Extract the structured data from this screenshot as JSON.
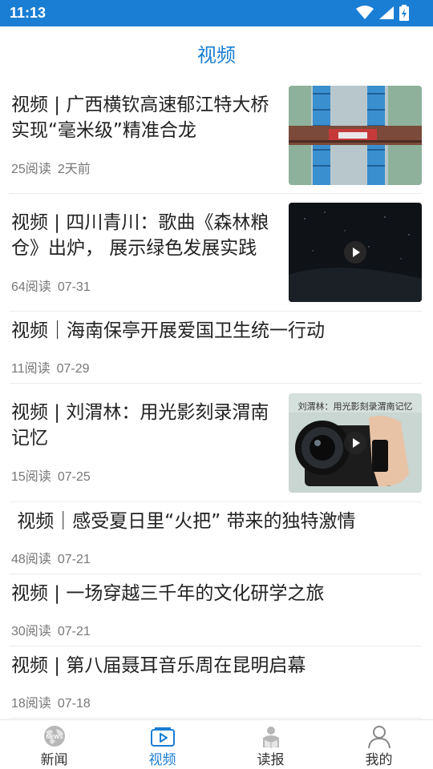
{
  "status_bar": {
    "time": "11:13"
  },
  "header": {
    "title": "视频"
  },
  "articles": [
    {
      "title": "视频 | 广西横钦高速郁江特大桥实现“毫米级”精准合龙",
      "reads": "25阅读",
      "date": "2天前",
      "has_thumbnail": true
    },
    {
      "title": "视频 | 四川青川：歌曲《森林粮仓》出炉， 展示绿色发展实践",
      "reads": "64阅读",
      "date": "07-31",
      "has_thumbnail": true,
      "play_icon": true
    },
    {
      "title": "视频｜海南保亭开展爱国卫生统一行动",
      "reads": "11阅读",
      "date": "07-29",
      "has_thumbnail": false
    },
    {
      "title": "视频 | 刘渭林：用光影刻录渭南记忆",
      "reads": "15阅读",
      "date": "07-25",
      "has_thumbnail": true,
      "play_icon": true,
      "thumbnail_caption": "刘渭林：用光影刻录渭南记忆"
    },
    {
      "title": " 视频｜感受夏日里“火把” 带来的独特激情",
      "reads": "48阅读",
      "date": "07-21",
      "has_thumbnail": false
    },
    {
      "title": "视频 | 一场穿越三千年的文化研学之旅",
      "reads": "30阅读",
      "date": "07-21",
      "has_thumbnail": false
    },
    {
      "title": "视频 | 第八届聂耳音乐周在昆明启幕",
      "reads": "18阅读",
      "date": "07-18",
      "has_thumbnail": false
    }
  ],
  "tab_bar": {
    "active": "视频",
    "news_icon_text": "NEWS",
    "tabs": [
      {
        "label": "新闻",
        "icon": "globe-news-icon"
      },
      {
        "label": "视频",
        "icon": "video-icon"
      },
      {
        "label": "读报",
        "icon": "reader-icon"
      },
      {
        "label": "我的",
        "icon": "profile-icon"
      }
    ]
  },
  "colors": {
    "accent": "#1a7ed4",
    "text": "#222222",
    "meta": "#777777"
  }
}
